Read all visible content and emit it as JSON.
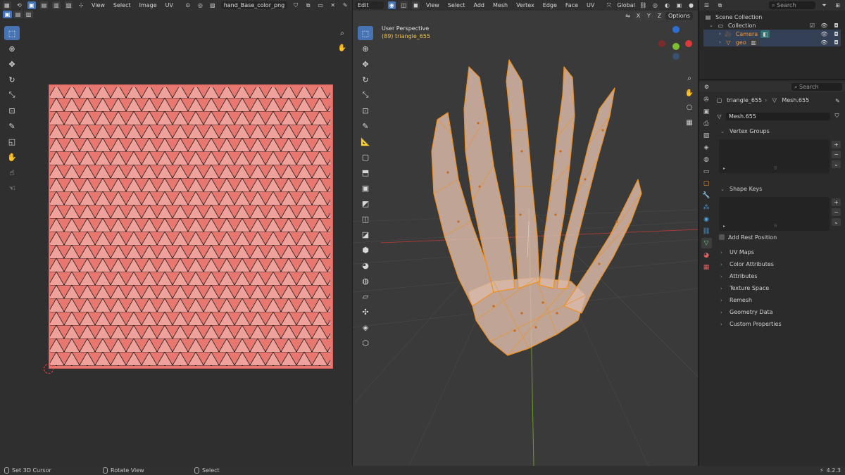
{
  "uv_editor": {
    "menus": [
      "View",
      "Select",
      "Image",
      "UV"
    ],
    "image_name": "hand_Base_color_png"
  },
  "viewport": {
    "mode": "Edit Mode",
    "menus": [
      "View",
      "Select",
      "Add",
      "Mesh",
      "Vertex",
      "Edge",
      "Face",
      "UV"
    ],
    "transform_orientation": "Global",
    "axis_labels": [
      "X",
      "Y",
      "Z"
    ],
    "options_label": "Options",
    "overlay_title": "User Perspective",
    "overlay_object": "(89) triangle_655"
  },
  "outliner": {
    "search_placeholder": "Search",
    "scene_collection": "Scene Collection",
    "collection": "Collection",
    "items": [
      "Camera",
      "geo"
    ]
  },
  "properties": {
    "search_placeholder": "Search",
    "object_name": "triangle_655",
    "mesh_name": "Mesh.655",
    "datablock": "Mesh.655",
    "vertex_groups": "Vertex Groups",
    "shape_keys": "Shape Keys",
    "add_rest_position": "Add Rest Position",
    "collapsed_panels": [
      "UV Maps",
      "Color Attributes",
      "Attributes",
      "Texture Space",
      "Remesh",
      "Geometry Data",
      "Custom Properties"
    ]
  },
  "statusbar": {
    "left": "Set 3D Cursor",
    "middle": "Rotate View",
    "right": "Select",
    "version": "4.2.3"
  },
  "colors": {
    "accent": "#4772b3",
    "uv_texture": "#e8776f",
    "mesh_orange": "#f0901e",
    "selected_object": "#f49a36"
  }
}
